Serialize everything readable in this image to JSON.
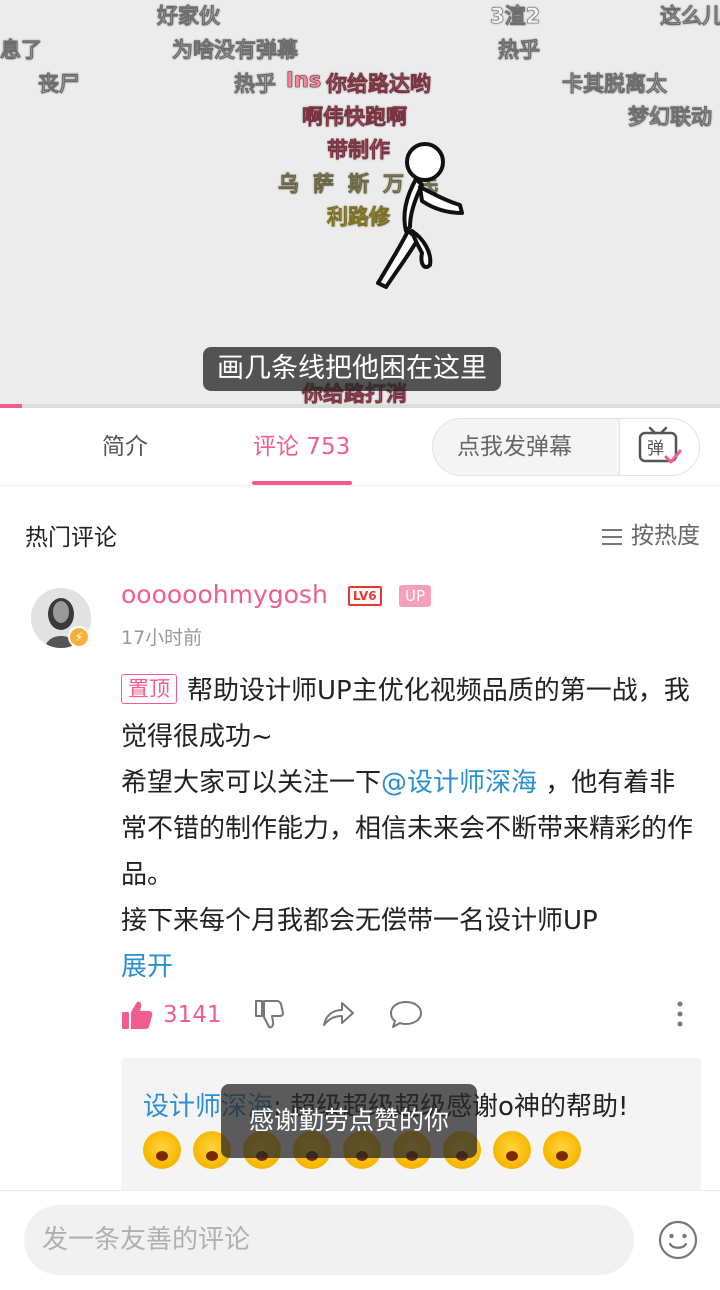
{
  "video": {
    "danmaku": [
      {
        "text": "好家伙",
        "style": "white"
      },
      {
        "text": "3渲2",
        "style": "white"
      },
      {
        "text": "这么儿",
        "style": "white"
      },
      {
        "text": "息了",
        "style": "white"
      },
      {
        "text": "为啥没有弹幕",
        "style": "white"
      },
      {
        "text": "热乎",
        "style": "white"
      },
      {
        "text": "丧尸",
        "style": "white"
      },
      {
        "text": "热乎",
        "style": "white"
      },
      {
        "text": "Ins",
        "style": "pink"
      },
      {
        "text": "你给路达哟",
        "style": "pink"
      },
      {
        "text": "卡其脱离太",
        "style": "white"
      },
      {
        "text": "啊伟快跑啊",
        "style": "pink"
      },
      {
        "text": "梦幻联动",
        "style": "white"
      },
      {
        "text": "带制作",
        "style": "pink"
      },
      {
        "text": "乌萨斯万民",
        "style": "tan"
      },
      {
        "text": "利路修",
        "style": "yellow"
      },
      {
        "text": "你给路打消",
        "style": "pink"
      }
    ],
    "subtitle": "画几条线把他困在这里",
    "progress": 0.03
  },
  "tabs": {
    "intro": "简介",
    "comments": "评论 753",
    "send_danmaku": "点我发弹幕",
    "danmaku_icon": "弹"
  },
  "hot": {
    "title": "热门评论",
    "sort": "按热度"
  },
  "comment": {
    "username": "oooooohmygosh",
    "level": "LV6",
    "up_badge": "UP",
    "time": "17小时前",
    "pin": "置顶",
    "line1": "帮助设计师UP主优化视频品质的第一战，我觉得很成功~",
    "line2_pre": "希望大家可以关注一下",
    "mention": "@设计师深海",
    "line2_post": " ，他有着非常不错的制作能力，相信未来会不断带来精彩的作品。",
    "line3": "接下来每个月我都会无偿带一名设计师UP",
    "expand": "展开",
    "likes": "3141"
  },
  "reply": {
    "user": "设计师深海",
    "text": ": 超级超级超级感谢o神的帮助!",
    "emoji_count": 9
  },
  "toast": "感谢勤劳点赞的你",
  "bottom": {
    "placeholder": "发一条友善的评论"
  },
  "colors": {
    "accent": "#f25d8e",
    "link": "#2b8fcf"
  }
}
